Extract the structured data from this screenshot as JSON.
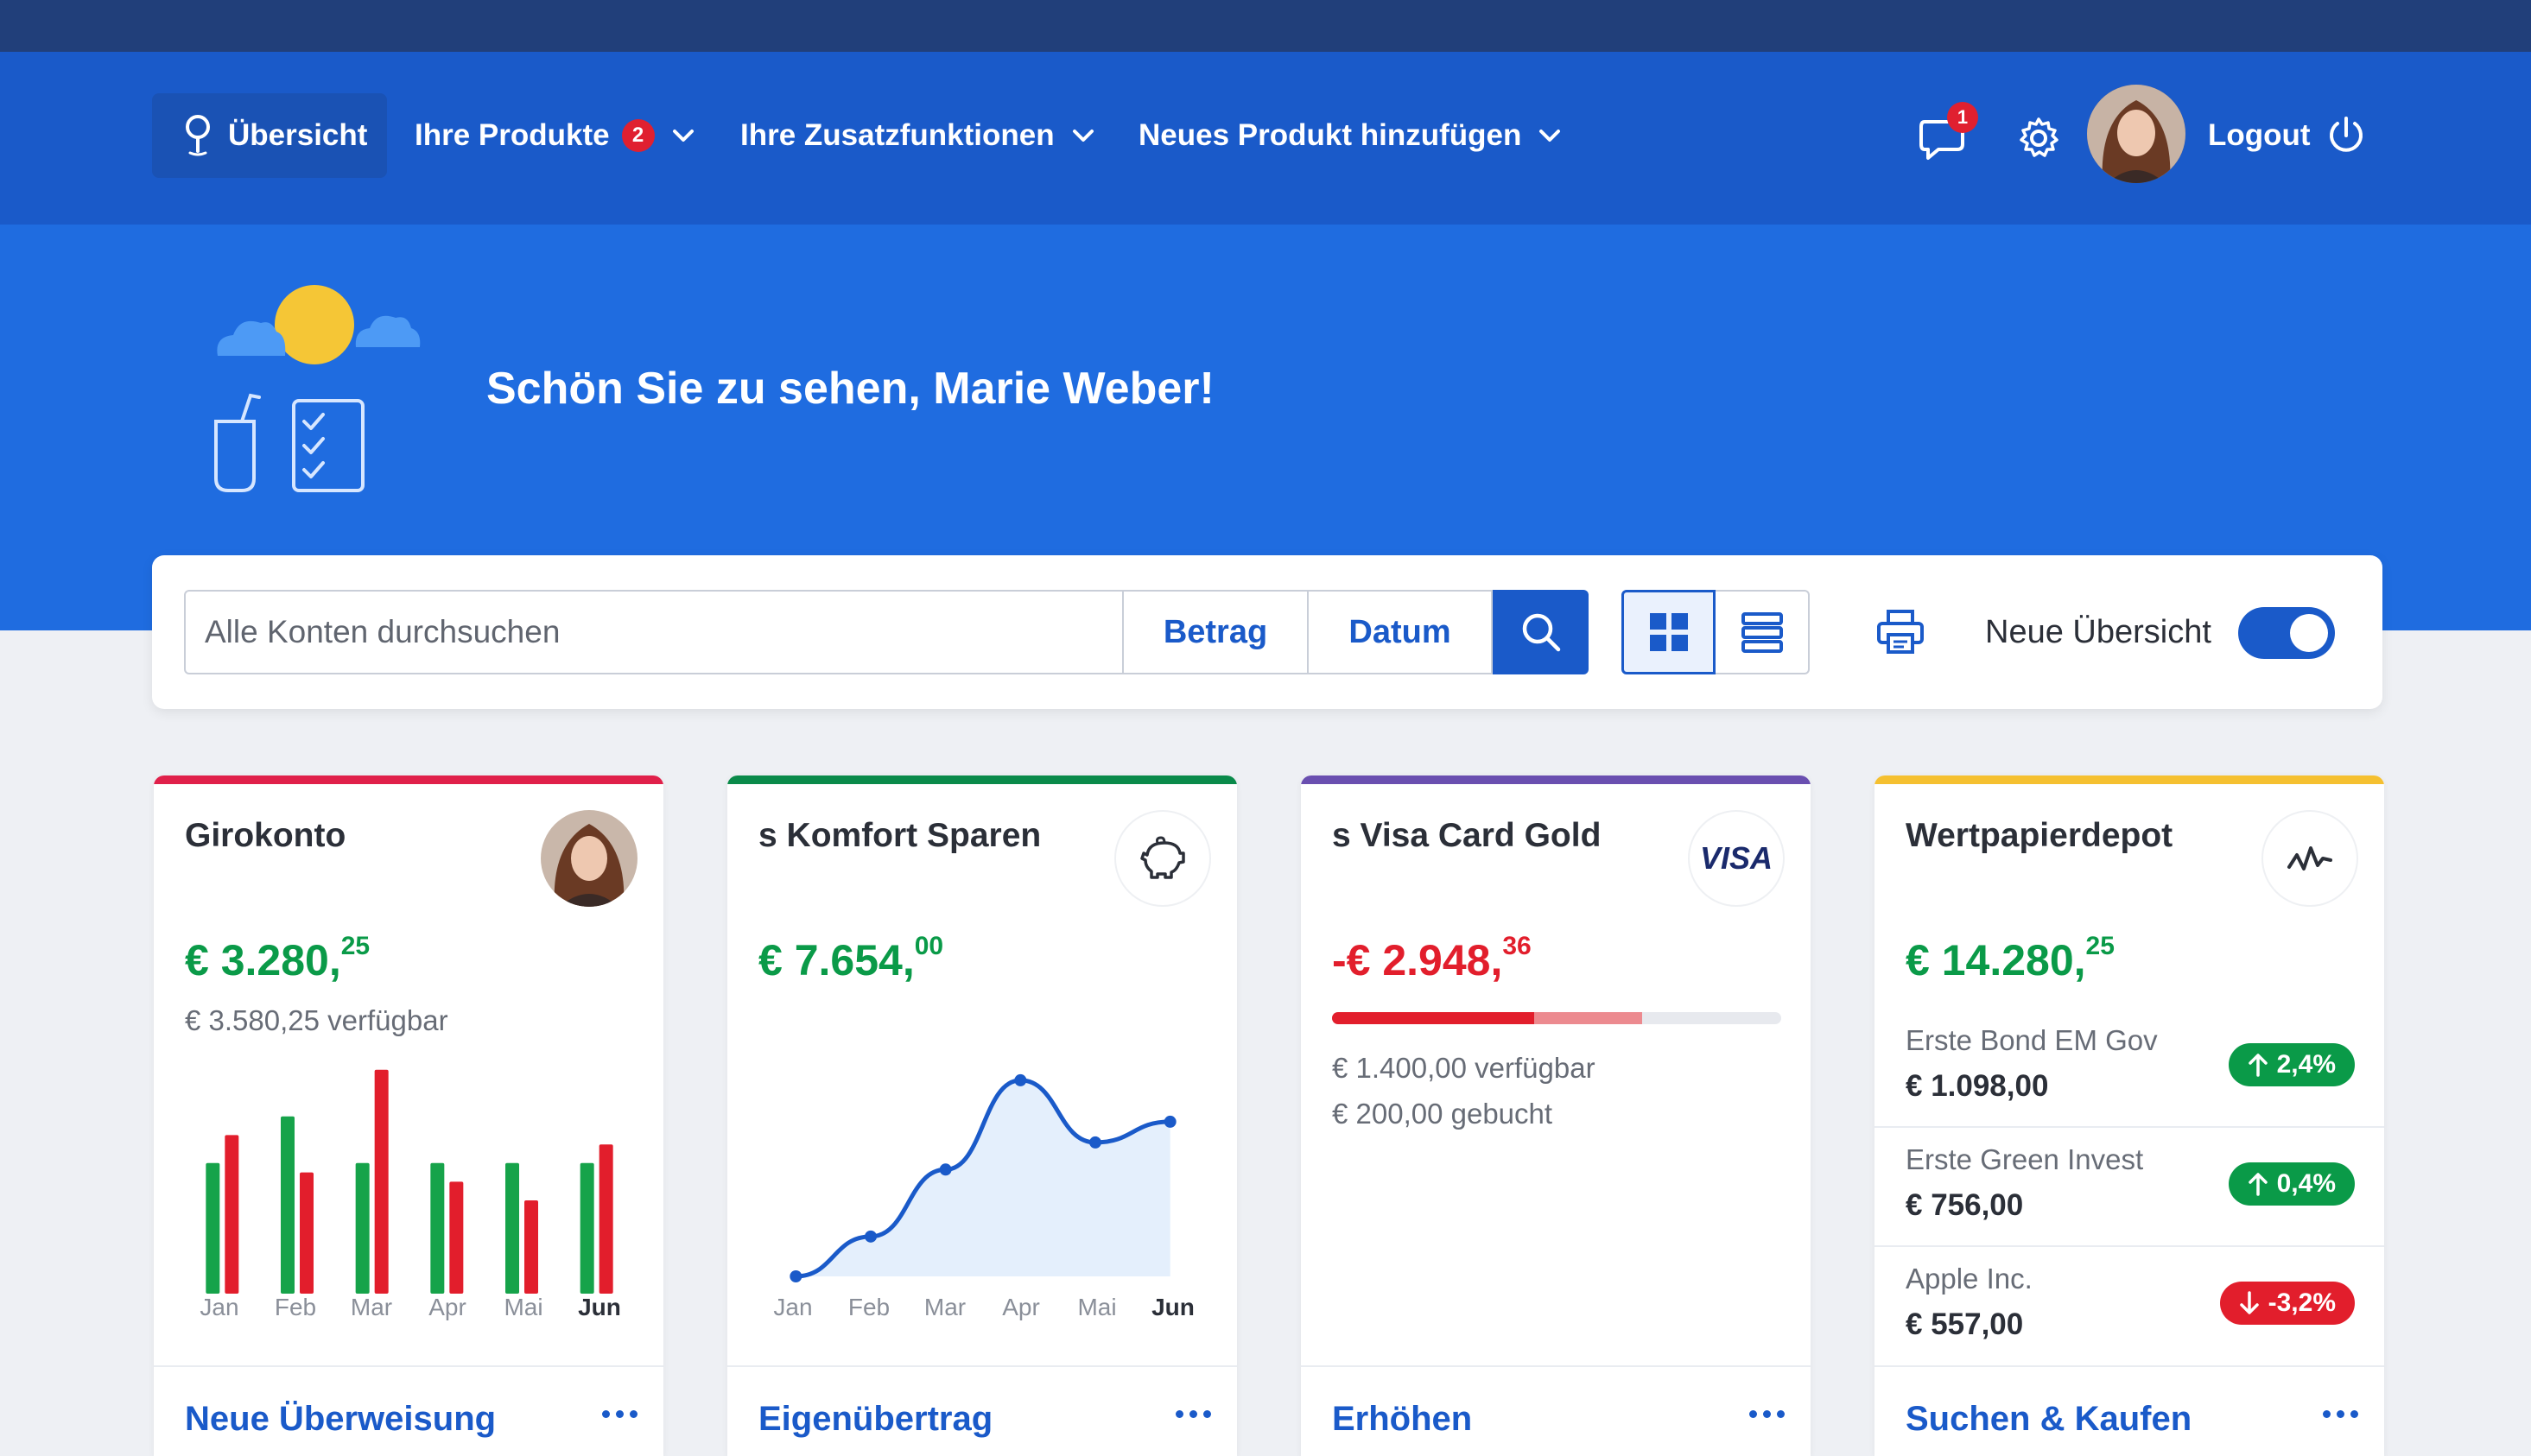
{
  "nav": {
    "home": "Übersicht",
    "products": "Ihre Produkte",
    "products_badge": "2",
    "extras": "Ihre Zusatzfunktionen",
    "add_product": "Neues Produkt hinzufügen",
    "messages_badge": "1",
    "logout": "Logout"
  },
  "hero": {
    "greeting": "Schön Sie zu sehen, Marie Weber!"
  },
  "search": {
    "placeholder": "Alle Konten durchsuchen",
    "filter_amount": "Betrag",
    "filter_date": "Datum",
    "toggle_label": "Neue Übersicht",
    "toggle_on": true
  },
  "cards": {
    "giro": {
      "title": "Girokonto",
      "balance_main": "€ 3.280,",
      "balance_cents": "25",
      "available": "€ 3.580,25 verfügbar",
      "footer": "Neue Überweisung",
      "accent": "#e0204a"
    },
    "saving": {
      "title": "s Komfort Sparen",
      "balance_main": "€ 7.654,",
      "balance_cents": "00",
      "footer": "Eigenübertrag",
      "accent": "#0a8a4a"
    },
    "visa": {
      "title": "s Visa Card Gold",
      "logo": "VISA",
      "balance_main": "-€ 2.948,",
      "balance_cents": "36",
      "used_fraction": 0.45,
      "booked_fraction": 0.24,
      "available": "€ 1.400,00 verfügbar",
      "booked": "€ 200,00 gebucht",
      "footer": "Erhöhen",
      "accent": "#6a4fb0"
    },
    "depot": {
      "title": "Wertpapierdepot",
      "balance_main": "€ 14.280,",
      "balance_cents": "25",
      "footer": "Suchen & Kaufen",
      "accent": "#f5c030",
      "positions": [
        {
          "name": "Erste Bond EM Gov",
          "value": "€ 1.098,00",
          "change": "2,4%",
          "direction": "up"
        },
        {
          "name": "Erste Green Invest",
          "value": "€ 756,00",
          "change": "0,4%",
          "direction": "up"
        },
        {
          "name": "Apple Inc.",
          "value": "€ 557,00",
          "change": "-3,2%",
          "direction": "down"
        }
      ]
    }
  },
  "colors": {
    "positive": "#0a9a48",
    "negative": "#e21e2c",
    "brand": "#1a5ac9"
  },
  "chart_data": [
    {
      "type": "bar",
      "categories": [
        "Jan",
        "Feb",
        "Mar",
        "Apr",
        "Mai",
        "Jun"
      ],
      "current": "Jun",
      "series": [
        {
          "values": [
            14,
            19,
            14,
            14,
            14,
            14
          ],
          "color": "#16a34a"
        },
        {
          "values": [
            17,
            13,
            24,
            12,
            10,
            16
          ],
          "color": "#e21e2c"
        }
      ],
      "ylim": [
        0,
        25
      ]
    },
    {
      "type": "area",
      "categories": [
        "Jan",
        "Feb",
        "Mar",
        "Apr",
        "Mai",
        "Jun"
      ],
      "current": "Jun",
      "values": [
        0,
        2.5,
        6.7,
        12.3,
        8.4,
        9.7
      ],
      "ylim": [
        0,
        13
      ]
    }
  ],
  "icons": {
    "home": "location-pin-icon",
    "messages": "chat-bubble-icon",
    "settings": "gear-icon",
    "logout": "power-icon",
    "search": "search-icon",
    "grid": "grid-view-icon",
    "list": "list-view-icon",
    "print": "printer-icon",
    "saving": "piggy-bank-icon",
    "depot": "stock-chart-icon"
  }
}
